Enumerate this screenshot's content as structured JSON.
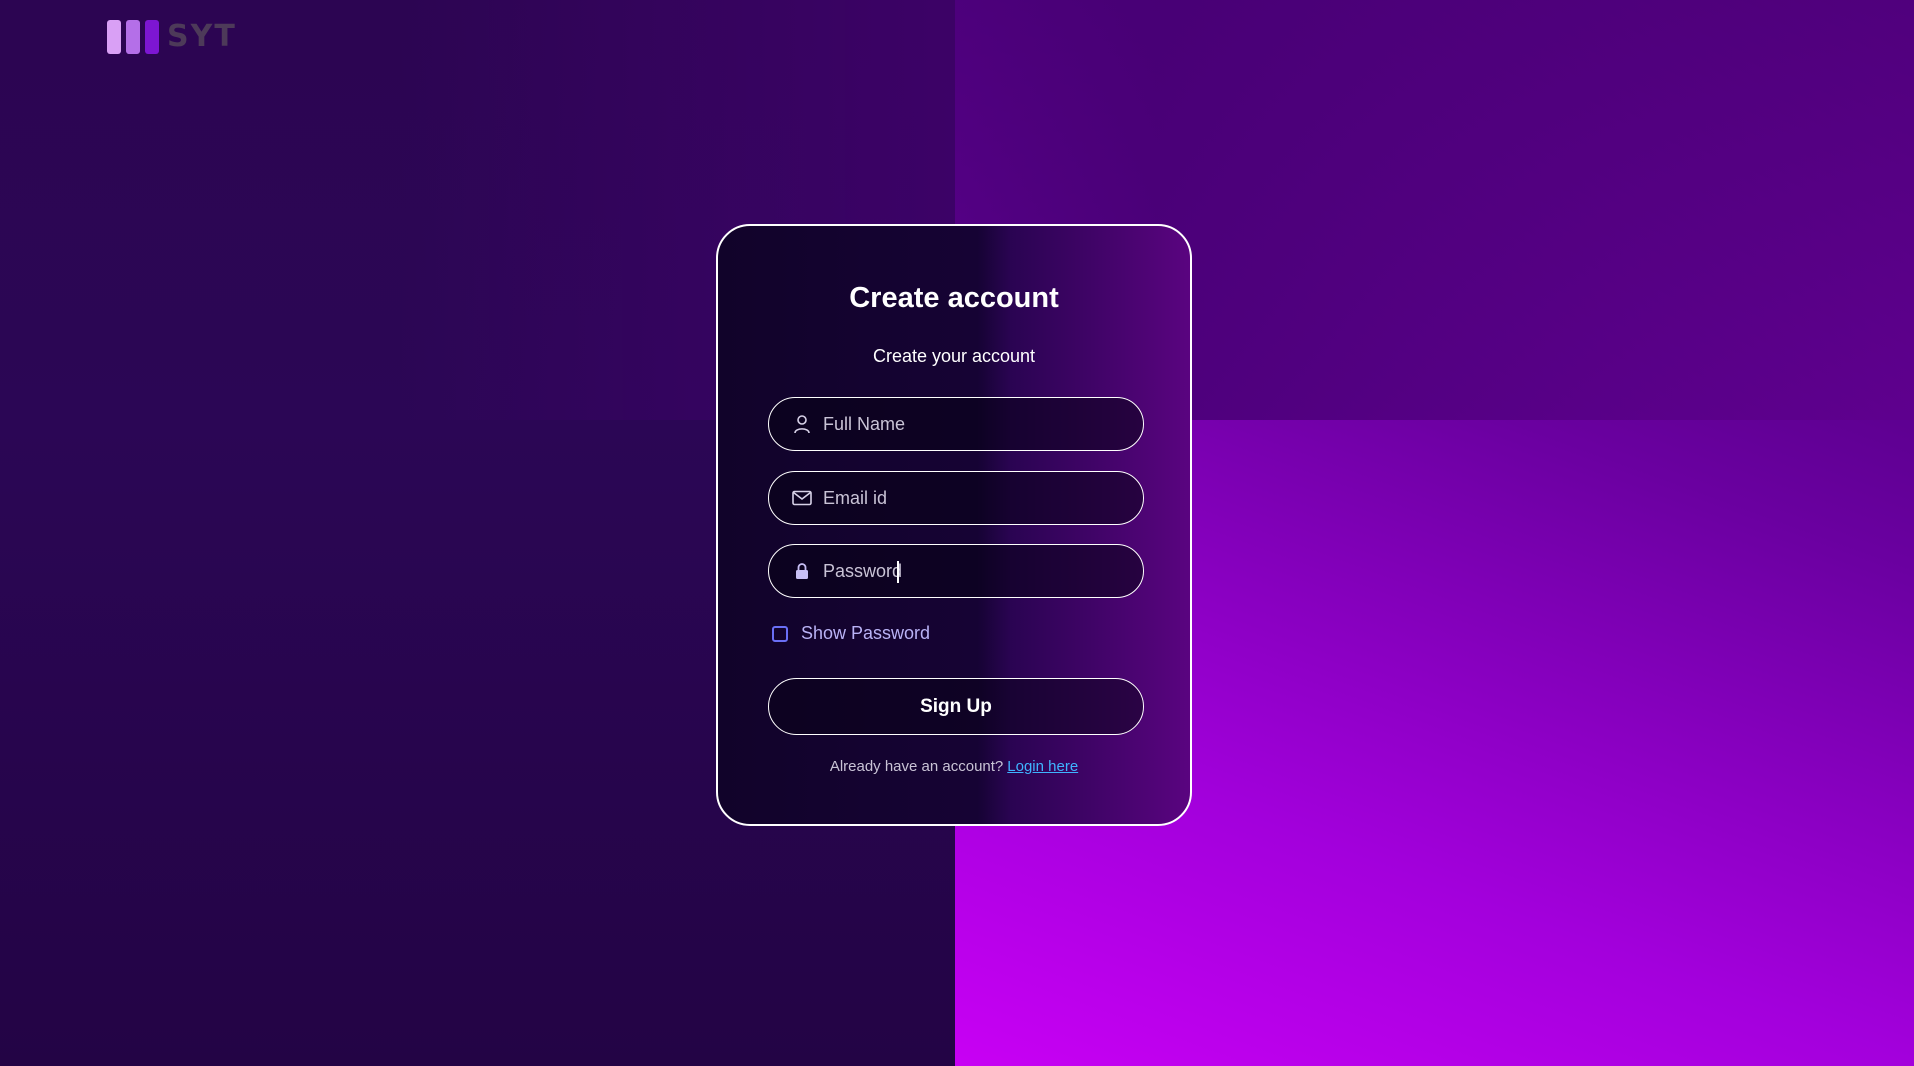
{
  "brand": {
    "logo_text": "SYT",
    "logo_bar_colors": [
      "#d9a0f5",
      "#b46fe8",
      "#7d16d2"
    ]
  },
  "form": {
    "title": "Create account",
    "subtitle": "Create your account",
    "fields": [
      {
        "icon": "user-icon",
        "placeholder": "Full Name",
        "value": ""
      },
      {
        "icon": "mail-icon",
        "placeholder": "Email id",
        "value": ""
      },
      {
        "icon": "lock-icon",
        "placeholder": "Password",
        "value": ""
      }
    ],
    "show_password_label": "Show Password",
    "show_password_checked": false,
    "submit_label": "Sign Up",
    "footer_text": "Already have an account?",
    "login_link_label": "Login here"
  },
  "colors": {
    "accent_link": "#3fb4ff",
    "checkbox_border": "#6a6ff5",
    "background_left": "#2c0552",
    "background_right": "#c800f4"
  }
}
